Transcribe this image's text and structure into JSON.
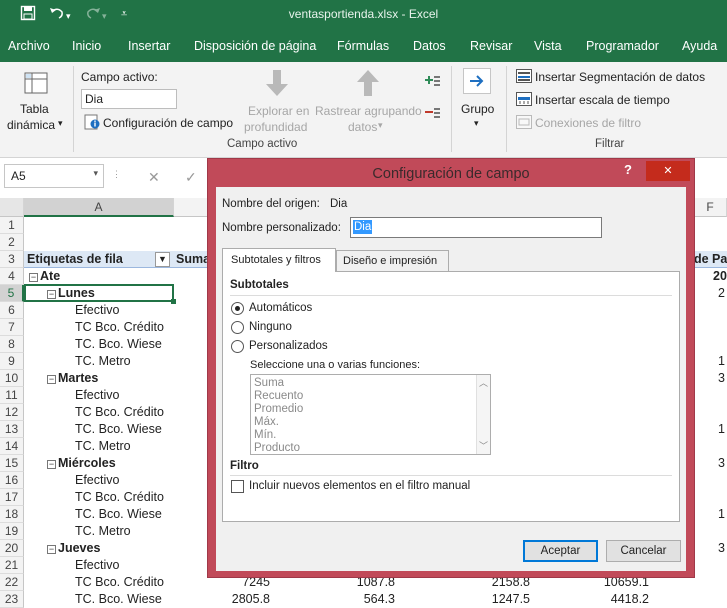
{
  "window": {
    "title": "ventasportienda.xlsx  -  Excel"
  },
  "menu": [
    "Archivo",
    "Inicio",
    "Insertar",
    "Disposición de página",
    "Fórmulas",
    "Datos",
    "Revisar",
    "Vista",
    "Programador",
    "Ayuda"
  ],
  "ribbon": {
    "tabla_dinamica": [
      "Tabla",
      "dinámica"
    ],
    "campo_activo_label": "Campo activo:",
    "campo_activo_value": "Dia",
    "configuracion_campo": "Configuración de campo",
    "explorar": [
      "Explorar en",
      "profundidad"
    ],
    "rastrear": [
      "Rastrear agrupando",
      "datos"
    ],
    "grupo_campo_activo": "Campo activo",
    "grupo": "Grupo",
    "insertar_segmentacion": "Insertar Segmentación de datos",
    "insertar_escala": "Insertar escala de tiempo",
    "conexiones_filtro": "Conexiones de filtro",
    "grupo_filtrar": "Filtrar"
  },
  "formula_bar": {
    "name_box": "A5"
  },
  "grid": {
    "col_headers": [
      "A",
      "F"
    ],
    "row_numbers": [
      "1",
      "2",
      "3",
      "4",
      "5",
      "6",
      "7",
      "8",
      "9",
      "10",
      "11",
      "12",
      "13",
      "14",
      "15",
      "16",
      "17",
      "18",
      "19",
      "20",
      "21",
      "22",
      "23"
    ],
    "row3_label": "Etiquetas de fila",
    "row3_b": "Suma",
    "row3_f": "de Pa",
    "rows": [
      "",
      "",
      "",
      "Ate",
      "Lunes",
      "Efectivo",
      "TC Bco. Crédito",
      "TC. Bco. Wiese",
      "TC. Metro",
      "Martes",
      "Efectivo",
      "TC Bco. Crédito",
      "TC. Bco. Wiese",
      "TC. Metro",
      "Miércoles",
      "Efectivo",
      "TC Bco. Crédito",
      "TC. Bco. Wiese",
      "TC. Metro",
      "Jueves",
      "Efectivo",
      "TC Bco. Crédito",
      "TC. Bco. Wiese"
    ],
    "f_values": [
      "20",
      "2",
      "1",
      "3",
      "1",
      "3",
      "1",
      "3"
    ],
    "row22_values": [
      "7245",
      "1087.8",
      "2158.8",
      "10659.1"
    ],
    "row23_values": [
      "2805.8",
      "564.3",
      "1247.5",
      "4418.2"
    ]
  },
  "dialog": {
    "title": "Configuración de campo",
    "help": "?",
    "close": "✕",
    "source_label": "Nombre del origen:",
    "source_value": "Dia",
    "custom_label": "Nombre personalizado:",
    "custom_value": "Dia",
    "tabs": [
      "Subtotales y filtros",
      "Diseño e impresión"
    ],
    "subtotales_heading": "Subtotales",
    "radio_auto": "Automáticos",
    "radio_none": "Ninguno",
    "radio_custom": "Personalizados",
    "functions_label": "Seleccione una o varias funciones:",
    "functions": [
      "Suma",
      "Recuento",
      "Promedio",
      "Máx.",
      "Mín.",
      "Producto"
    ],
    "filtro_heading": "Filtro",
    "include_new": "Incluir nuevos elementos en el filtro manual",
    "accept": "Aceptar",
    "cancel": "Cancelar"
  }
}
